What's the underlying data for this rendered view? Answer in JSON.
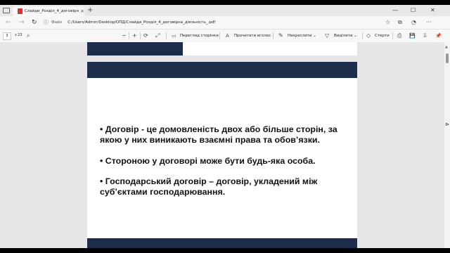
{
  "browser": {
    "tab": {
      "title": "Слайди_Розділ_4_договірна_ді...",
      "close": "×"
    },
    "new_tab": "+",
    "window_controls": {
      "minimize": "—",
      "maximize": "☐",
      "close": "✕"
    },
    "nav": {
      "back": "←",
      "forward": "→",
      "refresh": "↻"
    },
    "address": {
      "info_icon": "ⓘ",
      "scheme_label": "Файл",
      "url": "C:/Users/Admin/Desktop/ОПД/Слайди_Розділ_4_договірна_діяльність_.pdf"
    },
    "right_tools": {
      "favorite": "☆",
      "collections": "⧉",
      "profile": "◔",
      "more": "···"
    }
  },
  "pdf_toolbar": {
    "page_input": "3",
    "page_total": "з 23",
    "search_icon": "⌕",
    "zoom_out": "−",
    "zoom_in": "+",
    "fit": "⤢",
    "rotate": "⟳",
    "page_view_label": "Перегляд сторінки",
    "read_aloud_label": "Прочитати вголос",
    "draw_label": "Накреслити",
    "highlight_label": "Виділити",
    "erase_label": "Стерти",
    "print": "⎙",
    "save": "💾",
    "save_as": "⇩",
    "pin": "📌"
  },
  "slide": {
    "bullets": [
      "• Договір - це домовленість двох або більше сторін, за якою у них виникають взаємні права та обов’язки.",
      "• Стороною у договорі може бути будь-яка особа.",
      "• Господарський договір – договір, укладений між суб’єктами господарювання."
    ]
  },
  "colors": {
    "slide_band": "#1f2d4d",
    "pdf_icon": "#d4332b"
  }
}
